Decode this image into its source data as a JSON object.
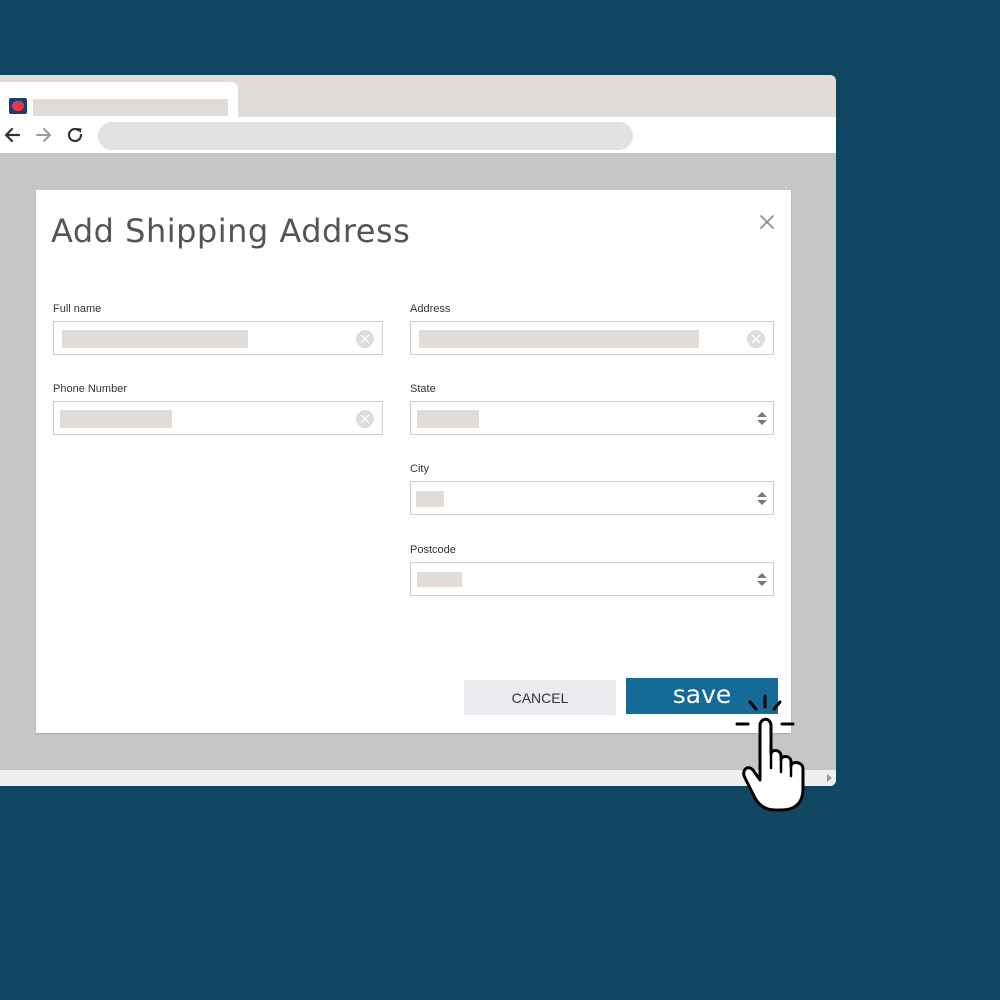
{
  "dialog": {
    "title": "Add Shipping Address",
    "fields": {
      "full_name": {
        "label": "Full name"
      },
      "phone": {
        "label": "Phone Number"
      },
      "address": {
        "label": "Address"
      },
      "state": {
        "label": "State"
      },
      "city": {
        "label": "City"
      },
      "postcode": {
        "label": "Postcode"
      }
    },
    "cancel_label": "CANCEL",
    "save_label": "save"
  },
  "icons": {
    "favicon": "site-favicon",
    "back": "arrow-left-icon",
    "forward": "arrow-right-icon",
    "reload": "reload-icon",
    "close": "close-icon",
    "clear": "clear-circle-icon",
    "spinner": "up-down-arrows-icon",
    "cursor": "pointing-hand-click-icon"
  },
  "colors": {
    "background": "#0f4662",
    "save_button": "#166a97",
    "cancel_button": "#ececf0",
    "placeholder_bar": "#e2dcd9"
  }
}
